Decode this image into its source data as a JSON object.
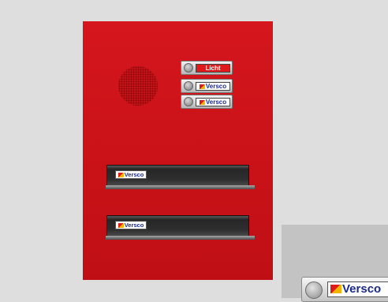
{
  "panel": {
    "buttons": [
      {
        "label": "Licht",
        "style": "red"
      },
      {
        "label": "Versco",
        "style": "logo"
      },
      {
        "label": "Versco",
        "style": "logo"
      }
    ],
    "nameplates": [
      {
        "label": "Versco"
      },
      {
        "label": "Versco"
      }
    ]
  },
  "zoom_preview": {
    "label": "Versco"
  },
  "colors": {
    "panel_red": "#d5161d",
    "background": "#dedede",
    "logo_text": "#1a2a8a"
  }
}
